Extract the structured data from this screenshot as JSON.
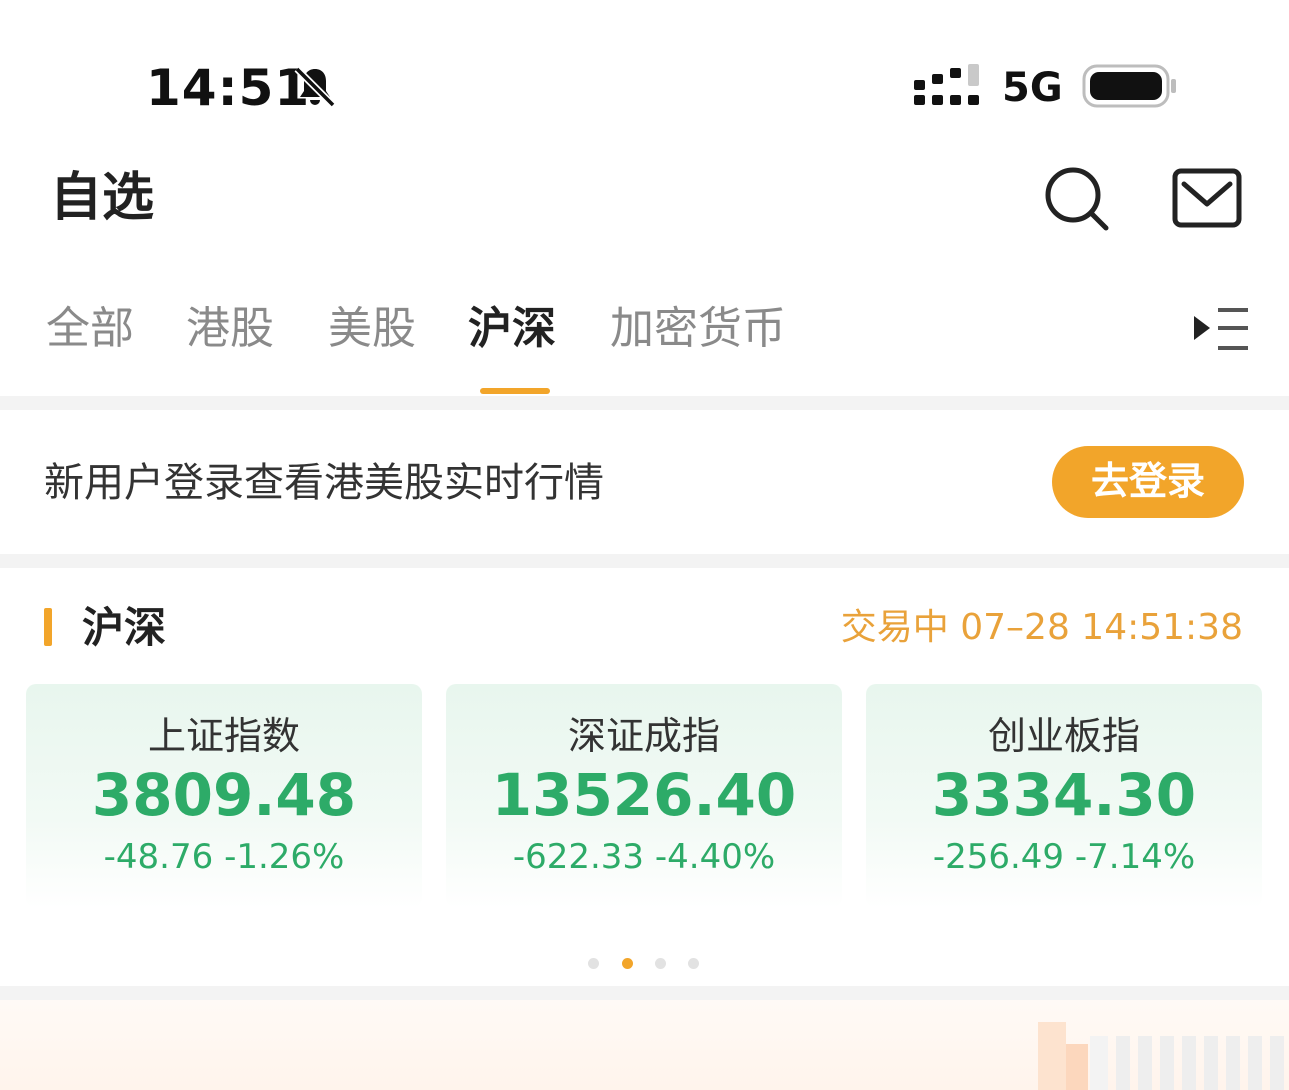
{
  "status_bar": {
    "time": "14:51",
    "network": "5G",
    "icons": [
      "bell-slash-icon",
      "signal-icon",
      "battery-icon"
    ]
  },
  "header": {
    "title": "自选",
    "icons": [
      "search-icon",
      "mail-icon"
    ]
  },
  "tabs": {
    "items": [
      {
        "label": "全部",
        "active": false
      },
      {
        "label": "港股",
        "active": false
      },
      {
        "label": "美股",
        "active": false
      },
      {
        "label": "沪深",
        "active": true
      },
      {
        "label": "加密货币",
        "active": false
      }
    ],
    "menu_icon": "tab-menu-icon"
  },
  "login_banner": {
    "text": "新用户登录查看港美股实时行情",
    "button_label": "去登录"
  },
  "market": {
    "title": "沪深",
    "status": "交易中 07–28 14:51:38",
    "indices": [
      {
        "name": "上证指数",
        "price": "3809.48",
        "change": "-48.76",
        "change_pct": "-1.26%"
      },
      {
        "name": "深证成指",
        "price": "13526.40",
        "change": "-622.33",
        "change_pct": "-4.40%"
      },
      {
        "name": "创业板指",
        "price": "3334.30",
        "change": "-256.49",
        "change_pct": "-7.14%"
      }
    ],
    "pager": {
      "count": 4,
      "active_index": 1
    }
  },
  "colors": {
    "accent": "#f2a52a",
    "down_green": "#2dab68",
    "status_orange": "#e9a23a",
    "card_bg": "#e8f6ee"
  }
}
